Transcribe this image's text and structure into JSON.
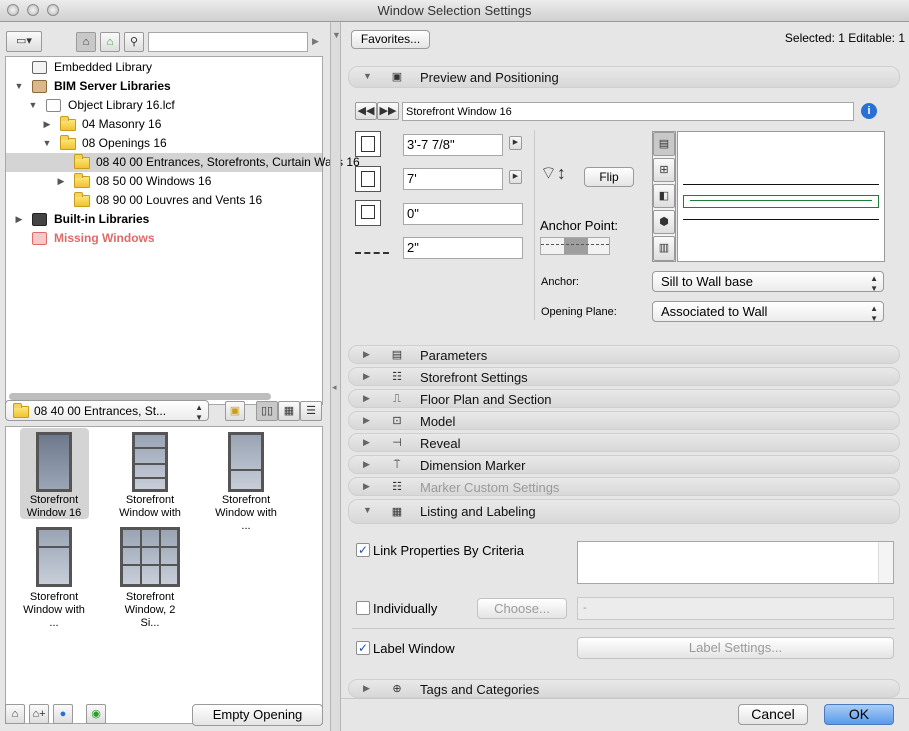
{
  "window": {
    "title": "Window Selection Settings"
  },
  "left": {
    "search": {
      "value": "",
      "placeholder": ""
    },
    "tree": [
      {
        "label": "Embedded Library",
        "bold": false,
        "missing": false
      },
      {
        "label": "BIM Server Libraries",
        "bold": true,
        "missing": false
      },
      {
        "label": "Object Library 16.lcf",
        "bold": false,
        "missing": false
      },
      {
        "label": "04 Masonry 16",
        "bold": false,
        "missing": false
      },
      {
        "label": "08 Openings 16",
        "bold": false,
        "missing": false
      },
      {
        "label": "08 40 00 Entrances, Storefronts, Curtain Walls 16",
        "bold": false,
        "missing": false
      },
      {
        "label": "08 50 00 Windows 16",
        "bold": false,
        "missing": false
      },
      {
        "label": "08 90 00 Louvres and Vents 16",
        "bold": false,
        "missing": false
      },
      {
        "label": "Built-in Libraries",
        "bold": true,
        "missing": false
      },
      {
        "label": "Missing Windows",
        "bold": true,
        "missing": true
      }
    ],
    "folder_popup": "08 40 00 Entrances, St...",
    "thumbnails": [
      {
        "line1": "Storefront",
        "line2": "Window 16"
      },
      {
        "line1": "Storefront",
        "line2": "Window with ..."
      },
      {
        "line1": "Storefront",
        "line2": "Window with ..."
      },
      {
        "line1": "Storefront",
        "line2": "Window with ..."
      },
      {
        "line1": "Storefront",
        "line2": "Window, 2 Si..."
      }
    ],
    "empty_opening_label": "Empty Opening"
  },
  "right": {
    "favorites_label": "Favorites...",
    "selected_status": "Selected: 1 Editable: 1",
    "preview_section": "Preview and Positioning",
    "object_name": "Storefront Window 16",
    "width": "3'-7 7/8\"",
    "height": "7'",
    "sill_height": "0\"",
    "reveal_depth": "2\"",
    "flip_label": "Flip",
    "anchor_point_label": "Anchor Point:",
    "anchor_label": "Anchor:",
    "anchor_value": "Sill to Wall base",
    "opening_plane_label": "Opening Plane:",
    "opening_plane_value": "Associated to Wall",
    "sections": [
      "Parameters",
      "Storefront Settings",
      "Floor Plan and Section",
      "Model",
      "Reveal",
      "Dimension Marker",
      "Marker Custom Settings",
      "Listing and Labeling"
    ],
    "link_properties_label": "Link Properties By Criteria",
    "individually_label": "Individually",
    "choose_label": "Choose...",
    "individual_field": "-",
    "label_window_label": "Label Window",
    "label_settings_label": "Label Settings...",
    "tags_section": "Tags and Categories",
    "cancel_label": "Cancel",
    "ok_label": "OK"
  },
  "colors": {
    "accent": "#4a8ae8",
    "missing": "#e06a6a",
    "selection": "#d4d4d4"
  }
}
